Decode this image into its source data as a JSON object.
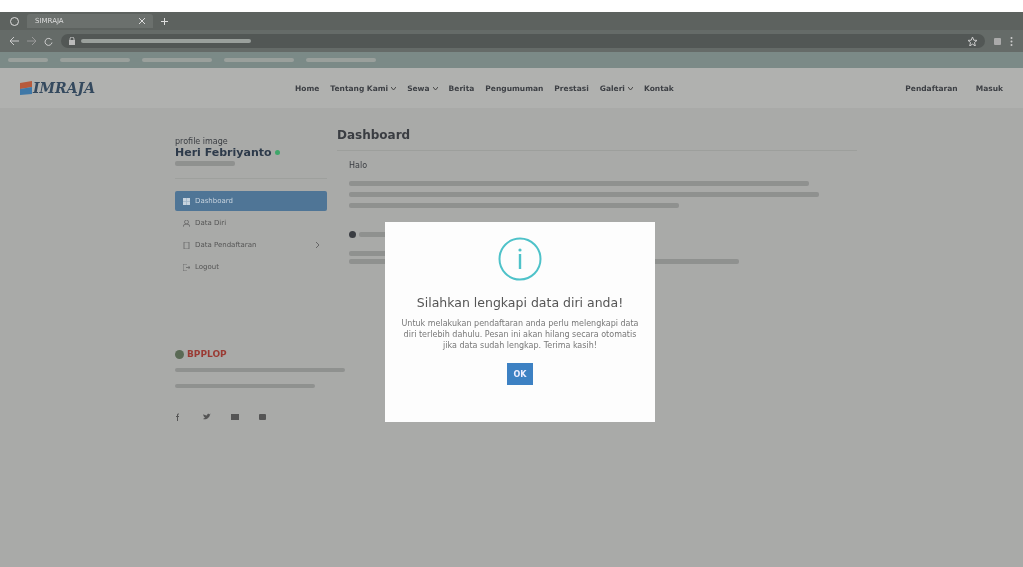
{
  "browser": {
    "tab_title": "SIMRAJA"
  },
  "site": {
    "logo": "IMRAJA",
    "nav": [
      {
        "label": "Home",
        "dropdown": false
      },
      {
        "label": "Tentang Kami",
        "dropdown": true
      },
      {
        "label": "Sewa",
        "dropdown": true
      },
      {
        "label": "Berita",
        "dropdown": false
      },
      {
        "label": "Pengumuman",
        "dropdown": false
      },
      {
        "label": "Prestasi",
        "dropdown": false
      },
      {
        "label": "Galeri",
        "dropdown": true
      },
      {
        "label": "Kontak",
        "dropdown": false
      }
    ],
    "nav_right": [
      "Pendaftaran",
      "Masuk"
    ]
  },
  "sidebar": {
    "profile_image_alt": "profile image",
    "name": "Heri Febriyanto",
    "online": true,
    "items": [
      {
        "label": "Dashboard",
        "selected": true,
        "has_submenu": false
      },
      {
        "label": "Data Diri",
        "selected": false,
        "has_submenu": false
      },
      {
        "label": "Data Pendaftaran",
        "selected": false,
        "has_submenu": true
      },
      {
        "label": "Logout",
        "selected": false,
        "has_submenu": false
      }
    ]
  },
  "main": {
    "title": "Dashboard",
    "greeting": "Halo"
  },
  "footer": {
    "logo": "BPPLOP"
  },
  "modal": {
    "title": "Silahkan lengkapi data diri anda!",
    "message": "Untuk melakukan pendaftaran anda perlu melengkapi data diri terlebih dahulu. Pesan ini akan hilang secara otomatis jika data sudah lengkap. Terima kasih!",
    "button": "OK"
  }
}
